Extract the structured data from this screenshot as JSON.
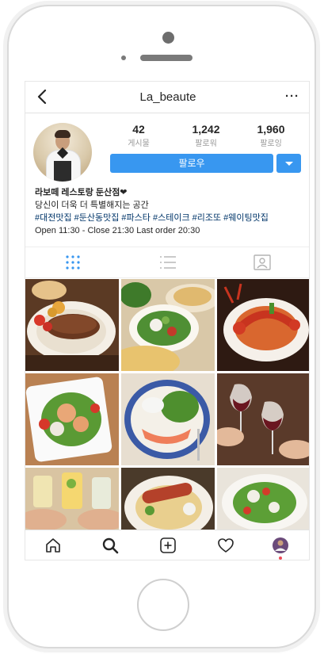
{
  "header": {
    "title": "La_beaute",
    "back_icon": "chevron-left-icon",
    "more_label": "···"
  },
  "profile": {
    "stats": [
      {
        "value": "42",
        "label": "게시물"
      },
      {
        "value": "1,242",
        "label": "팔로워"
      },
      {
        "value": "1,960",
        "label": "팔로잉"
      }
    ],
    "follow_label": "팔로우",
    "bio": {
      "name": "라보떼 레스토랑 둔산점❤",
      "line1": "당신이 더욱 더 특별해지는 공간",
      "tags": "#대전맛집 #둔산동맛집 #파스타 #스테이크 #리조또 #웨이팅맛집",
      "hours": "Open 11:30 - Close 21:30 Last order 20:30"
    }
  },
  "view_tabs": [
    "grid-icon",
    "list-icon",
    "tagged-icon"
  ],
  "grid": [
    "steak",
    "salad-pizza",
    "lobster-pasta",
    "chicken-salad",
    "salmon-salad",
    "wine-toast",
    "cocktails",
    "sausage-pasta",
    "green-salad"
  ],
  "bottom_nav": [
    "home-icon",
    "search-icon",
    "add-icon",
    "heart-icon",
    "profile-icon"
  ],
  "colors": {
    "accent": "#3897f0",
    "hashtag": "#003569",
    "notification": "#ed4956"
  }
}
